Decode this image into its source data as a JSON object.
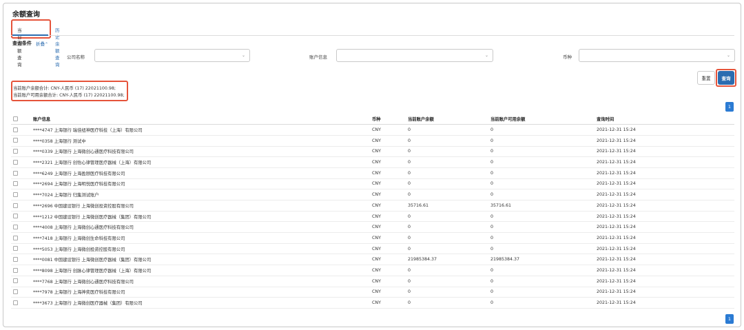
{
  "page": {
    "title": "余额查询"
  },
  "tabs": [
    {
      "label": "当日余额查询",
      "active": true
    },
    {
      "label": "历史余额查询",
      "active": false
    }
  ],
  "filters": {
    "header": "查询条件",
    "collapse_label": "折叠",
    "company": {
      "label": "公司名称",
      "value": ""
    },
    "account": {
      "label": "账户信息",
      "value": ""
    },
    "currency": {
      "label": "币种",
      "value": ""
    }
  },
  "buttons": {
    "reset": "重置",
    "query": "查询"
  },
  "summary": {
    "balance_total": "当前账户余额合计: CNY-人民币 (17) 22021100.98;",
    "available_total": "当前账户可用余额合计: CNY-人民币 (17) 22021100.98;"
  },
  "pagination": {
    "page": "1"
  },
  "table": {
    "columns": [
      "账户信息",
      "币种",
      "当前账户余额",
      "当前账户可用余额",
      "查询时间"
    ],
    "rows": [
      {
        "account": "****4747 上海银行 瑞佳纽神医疗科技（上海）有限公司",
        "currency": "CNY",
        "balance": "0",
        "available": "0",
        "time": "2021-12-31 15:24"
      },
      {
        "account": "****0358 上海银行 测试中",
        "currency": "CNY",
        "balance": "0",
        "available": "0",
        "time": "2021-12-31 15:24"
      },
      {
        "account": "****0339 上海银行 上海微创心通医疗科技有限公司",
        "currency": "CNY",
        "balance": "0",
        "available": "0",
        "time": "2021-12-31 15:24"
      },
      {
        "account": "****2321 上海银行 创怡心律管理医疗器械（上海）有限公司",
        "currency": "CNY",
        "balance": "0",
        "available": "0",
        "time": "2021-12-31 15:24"
      },
      {
        "account": "****6249 上海银行 上海盈颐医疗科技有限公司",
        "currency": "CNY",
        "balance": "0",
        "available": "0",
        "time": "2021-12-31 15:24"
      },
      {
        "account": "****2694 上海银行 上海明悦医疗科技有限公司",
        "currency": "CNY",
        "balance": "0",
        "available": "0",
        "time": "2021-12-31 15:24"
      },
      {
        "account": "****7024 上海银行 归集测试账户",
        "currency": "CNY",
        "balance": "0",
        "available": "0",
        "time": "2021-12-31 15:24"
      },
      {
        "account": "****2696 中国建设银行 上海微创投资控股有限公司",
        "currency": "CNY",
        "balance": "35716.61",
        "available": "35716.61",
        "time": "2021-12-31 15:24"
      },
      {
        "account": "****1212 中国建设银行 上海微创医疗器械（集团）有限公司",
        "currency": "CNY",
        "balance": "0",
        "available": "0",
        "time": "2021-12-31 15:24"
      },
      {
        "account": "****4008 上海银行 上海微创心通医疗科技有限公司",
        "currency": "CNY",
        "balance": "0",
        "available": "0",
        "time": "2021-12-31 15:24"
      },
      {
        "account": "****7418 上海银行 上海微创生命科技有限公司",
        "currency": "CNY",
        "balance": "0",
        "available": "0",
        "time": "2021-12-31 15:24"
      },
      {
        "account": "****5053 上海银行 上海微创投资控股有限公司",
        "currency": "CNY",
        "balance": "0",
        "available": "0",
        "time": "2021-12-31 15:24"
      },
      {
        "account": "****0081 中国建设银行 上海微创医疗器械（集团）有限公司",
        "currency": "CNY",
        "balance": "21985384.37",
        "available": "21985384.37",
        "time": "2021-12-31 15:24"
      },
      {
        "account": "****8098 上海银行 创脉心律管理医疗器械（上海）有限公司",
        "currency": "CNY",
        "balance": "0",
        "available": "0",
        "time": "2021-12-31 15:24"
      },
      {
        "account": "****7768 上海银行 上海微创心通医疗科技有限公司",
        "currency": "CNY",
        "balance": "0",
        "available": "0",
        "time": "2021-12-31 15:24"
      },
      {
        "account": "****7978 上海银行 上海神奕医疗科技有限公司",
        "currency": "CNY",
        "balance": "0",
        "available": "0",
        "time": "2021-12-31 15:24"
      },
      {
        "account": "****3673 上海银行 上海微创医疗器械（集团）有限公司",
        "currency": "CNY",
        "balance": "0",
        "available": "0",
        "time": "2021-12-31 15:24"
      }
    ]
  }
}
